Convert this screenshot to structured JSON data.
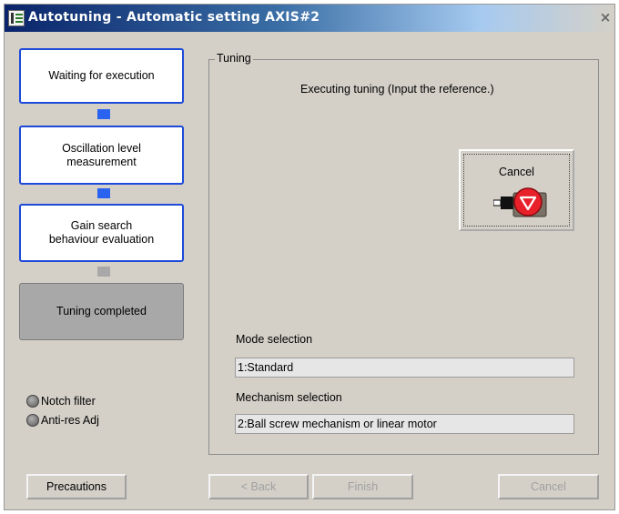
{
  "window": {
    "title": "Autotuning - Automatic setting AXIS#2",
    "close_glyph": "×"
  },
  "steps": [
    {
      "label": "Waiting for execution",
      "state": "active"
    },
    {
      "label": "Oscillation level\nmeasurement",
      "state": "active"
    },
    {
      "label": "Gain search\nbehaviour evaluation",
      "state": "active"
    },
    {
      "label": "Tuning completed",
      "state": "completed"
    }
  ],
  "options": [
    {
      "label": "Notch filter"
    },
    {
      "label": "Anti-res Adj"
    }
  ],
  "tuning": {
    "legend": "Tuning",
    "status": "Executing tuning (Input the reference.)",
    "cancel_label": "Cancel",
    "cancel_icon": "stop-motor-icon",
    "mode_label": "Mode selection",
    "mode_value": "1:Standard",
    "mechanism_label": "Mechanism selection",
    "mechanism_value": "2:Ball screw mechanism or linear motor"
  },
  "footer": {
    "precautions": "Precautions",
    "back": "< Back",
    "finish": "Finish",
    "cancel": "Cancel"
  },
  "colors": {
    "active_border": "#1d4ad8",
    "connector_active": "#2a63f0",
    "completed_fill": "#a8a8a8",
    "stop_red": "#e8202a",
    "window_bg": "#d4d0c8"
  }
}
